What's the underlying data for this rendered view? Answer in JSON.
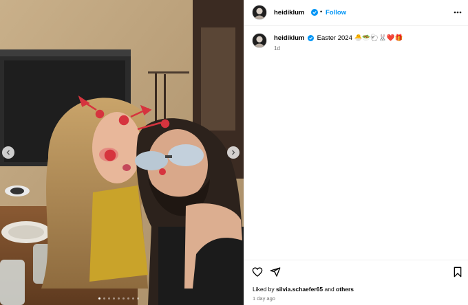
{
  "post": {
    "author": "heidiklum",
    "follow_label": "Follow",
    "separator": "•",
    "caption": "Easter 2024 🐣🥗🐑🐰❤️🎁",
    "age_short": "1d",
    "likes_prefix": "Liked by",
    "liked_by_user": "silvia.schaefer65",
    "likes_and": "and",
    "likes_others": "others",
    "timestamp": "1 day ago"
  },
  "carousel": {
    "slide_count": 9,
    "active_index": 0
  },
  "colors": {
    "accent": "#0095f6",
    "verified": "#0095f6",
    "muted_text": "#737373",
    "divider": "#efefef"
  },
  "icons": {
    "verified": "verified-badge-icon",
    "more": "more-options-icon",
    "like": "heart-icon",
    "share": "share-icon",
    "save": "bookmark-icon",
    "prev": "chevron-left-icon",
    "next": "chevron-right-icon"
  }
}
